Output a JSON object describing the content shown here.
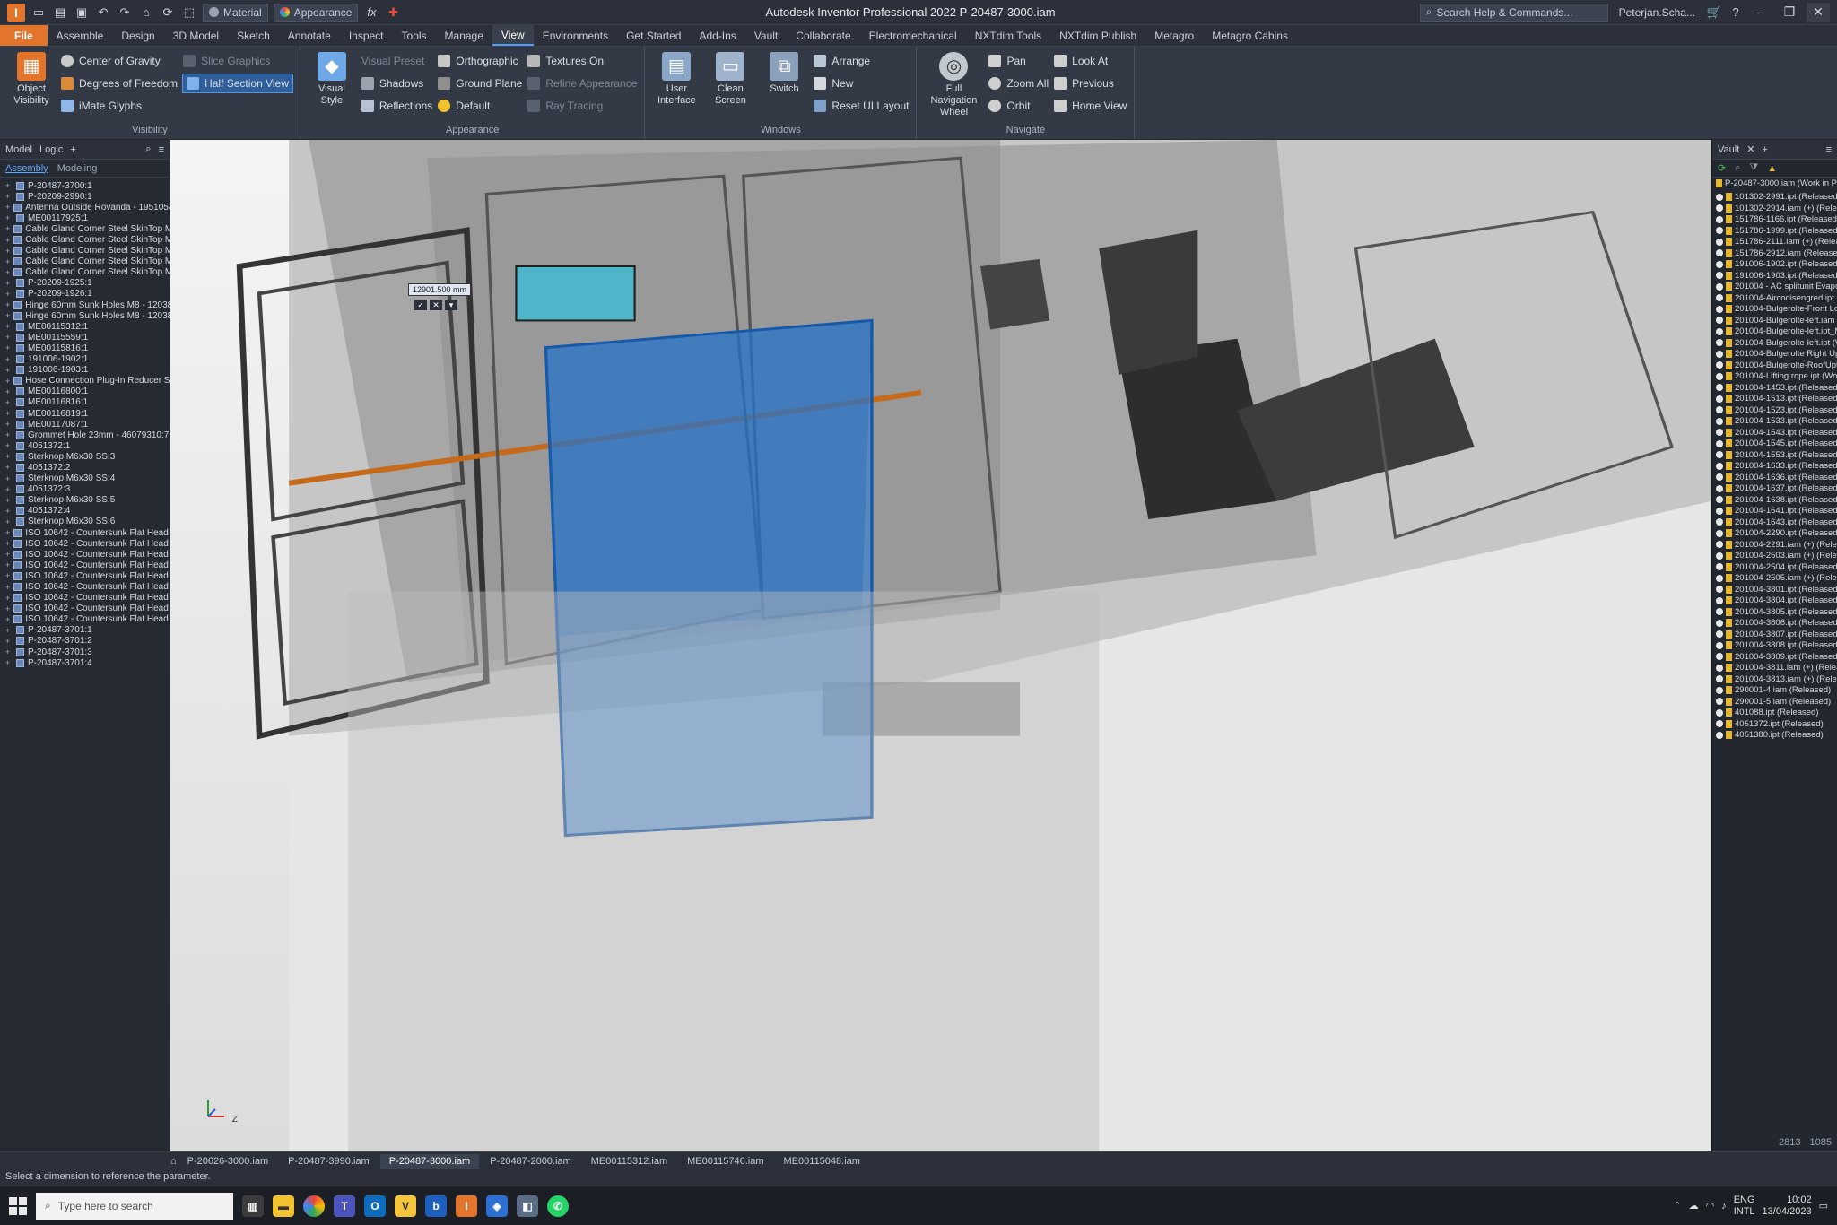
{
  "titlebar": {
    "app_letter": "I",
    "material": "Material",
    "appearance": "Appearance",
    "fx": "fx",
    "title": "Autodesk Inventor Professional 2022   P-20487-3000.iam",
    "search": "Search Help & Commands...",
    "user": "Peterjan.Scha..."
  },
  "tabs": [
    "File",
    "Assemble",
    "Design",
    "3D Model",
    "Sketch",
    "Annotate",
    "Inspect",
    "Tools",
    "Manage",
    "View",
    "Environments",
    "Get Started",
    "Add-Ins",
    "Vault",
    "Collaborate",
    "Electromechanical",
    "NXTdim Tools",
    "NXTdim Publish",
    "Metagro",
    "Metagro Cabins"
  ],
  "ribbon": {
    "visibility": {
      "title": "Visibility",
      "object_visibility": "Object Visibility",
      "center_of_gravity": "Center of Gravity",
      "degrees_of_freedom": "Degrees of Freedom",
      "imate_glyphs": "iMate Glyphs",
      "slice_graphics": "Slice Graphics",
      "half_section_view": "Half Section View"
    },
    "appearance": {
      "title": "Appearance",
      "visual_style": "Visual Style",
      "visual_preset": "Visual Preset",
      "shadows": "Shadows",
      "reflections": "Reflections",
      "orthographic": "Orthographic",
      "ground_plane": "Ground Plane",
      "default": "Default",
      "textures_on": "Textures On",
      "refine_appearance": "Refine Appearance",
      "ray_tracing": "Ray Tracing"
    },
    "windows": {
      "title": "Windows",
      "user_interface": "User Interface",
      "clean_screen": "Clean Screen",
      "switch": "Switch",
      "arrange": "Arrange",
      "new": "New",
      "reset_ui_layout": "Reset UI Layout"
    },
    "navigate": {
      "title": "Navigate",
      "full_navigation_wheel": "Full Navigation Wheel",
      "pan": "Pan",
      "zoom_all": "Zoom All",
      "orbit": "Orbit",
      "look_at": "Look At",
      "previous": "Previous",
      "home_view": "Home View"
    }
  },
  "browser": {
    "tab_model": "Model",
    "tab_logic": "Logic",
    "sub_assembly": "Assembly",
    "sub_modeling": "Modeling",
    "items": [
      "P-20487-3700:1",
      "P-20209-2990:1",
      "Antenna Outside Rovanda - 1951054:1",
      "ME00117925:1",
      "Cable Gland Corner Steel SkinTop M25x1,5 - 712",
      "Cable Gland Corner Steel SkinTop M25x1,5 - 712",
      "Cable Gland Corner Steel SkinTop M25x1,5 - 712",
      "Cable Gland Corner Steel SkinTop M25x1,5 - 712",
      "Cable Gland Corner Steel SkinTop M25x1,5 - 712",
      "P-20209-1925:1",
      "P-20209-1926:1",
      "Hinge 60mm Sunk Holes M8 - 1203811:1",
      "Hinge 60mm Sunk Holes M8 - 1203811:2",
      "ME00115312:1",
      "ME00115559:1",
      "ME00115816:1",
      "191006-1902:1",
      "191006-1903:1",
      "Hose Connection Plug-In Reducer SS 8-10 - 714",
      "ME00116800:1",
      "ME00116816:1",
      "ME00116819:1",
      "ME00117087:1",
      "Grommet Hole 23mm - 46079310:7",
      "4051372:1",
      "Sterknop M6x30 SS:3",
      "4051372:2",
      "Sterknop M6x30 SS:4",
      "4051372:3",
      "Sterknop M6x30 SS:5",
      "4051372:4",
      "Sterknop M6x30 SS:6",
      "ISO 10642 - Countersunk Flat Head Screw - M8x",
      "ISO 10642 - Countersunk Flat Head Screw - M8x",
      "ISO 10642 - Countersunk Flat Head Screw - M8x",
      "ISO 10642 - Countersunk Flat Head Screw - M8x",
      "ISO 10642 - Countersunk Flat Head Screw - M8x",
      "ISO 10642 - Countersunk Flat Head Screw - M8x",
      "ISO 10642 - Countersunk Flat Head Screw - M8x",
      "ISO 10642 - Countersunk Flat Head Screw - M8x",
      "ISO 10642 - Countersunk Flat Head Screw - M8x",
      "P-20487-3701:1",
      "P-20487-3701:2",
      "P-20487-3701:3",
      "P-20487-3701:4"
    ]
  },
  "viewport": {
    "dimension_value": "12901.500 mm",
    "triad_z": "Z"
  },
  "vault": {
    "title": "Vault",
    "root": "P-20487-3000.iam (Work in Progress)",
    "items": [
      "101302-2991.ipt (Released)",
      "101302-2914.iam (+) (Released)",
      "151786-1166.ipt (Released)",
      "151786-1999.ipt (Released)",
      "151786-2111.iam (+) (Released)",
      "151786-2912.iam (Released)",
      "191006-1902.ipt (Released)",
      "191006-1903.ipt (Released)",
      "201004 - AC splitunit Evaporator Mitsubi",
      "201004-Aircodisengred.ipt (Work in Progress)",
      "201004-Bulgerolte-Front Low.ipt (Work in",
      "201004-Bulgerolte-left.iam (Work in Pro",
      "201004-Bulgerolte-left.ipt_MIR_(2) (Work",
      "201004-Bulgerolte-left.ipt (Work in Pro",
      "201004-Bulgerolte Right Up.ipt (Work in P",
      "201004-Bulgerolte-RoofUpt (Work in Prog",
      "201004-Lifting rope.ipt (Work in Progress)",
      "201004-1453.ipt (Released)",
      "201004-1513.ipt (Released)",
      "201004-1523.ipt (Released)",
      "201004-1533.ipt (Released)",
      "201004-1543.ipt (Released)",
      "201004-1545.ipt (Released)",
      "201004-1553.ipt (Released)",
      "201004-1633.ipt (Released)",
      "201004-1636.ipt (Released)",
      "201004-1637.ipt (Released)",
      "201004-1638.ipt (Released)",
      "201004-1641.ipt (Released)",
      "201004-1643.ipt (Released)",
      "201004-2290.ipt (Released)",
      "201004-2291.iam (+) (Released)",
      "201004-2503.iam (+) (Released)",
      "201004-2504.ipt (Released)",
      "201004-2505.iam (+) (Released)",
      "201004-3801.ipt (Released)",
      "201004-3804.ipt (Released)",
      "201004-3805.ipt (Released)",
      "201004-3806.ipt (Released)",
      "201004-3807.ipt (Released)",
      "201004-3808.ipt (Released)",
      "201004-3809.ipt (Released)",
      "201004-3811.iam (+) (Released)",
      "201004-3813.iam (+) (Released)",
      "290001-4.iam (Released)",
      "290001-5.iam (Released)",
      "401088.ipt (Released)",
      "4051372.ipt (Released)",
      "4051380.ipt (Released)"
    ],
    "footer_a": "2813",
    "footer_b": "1085"
  },
  "doc_tabs": [
    "P-20626-3000.iam",
    "P-20487-3990.iam",
    "P-20487-3000.iam",
    "P-20487-2000.iam",
    "ME00115312.iam",
    "ME00115746.iam",
    "ME00115048.iam"
  ],
  "prompt": "Select a dimension to reference the parameter.",
  "taskbar": {
    "search": "Type here to search",
    "lang": "ENG",
    "lang2": "INTL",
    "time": "10:02",
    "date": "13/04/2023"
  }
}
